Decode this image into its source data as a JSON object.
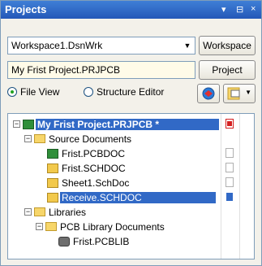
{
  "panel": {
    "title": "Projects",
    "title_buttons": [
      "▾",
      "⊟",
      "×"
    ]
  },
  "workspace": {
    "value": "Workspace1.DsnWrk",
    "button_label": "Workspace"
  },
  "project": {
    "value": "My Frist Project.PRJPCB",
    "button_label": "Project"
  },
  "view": {
    "options": [
      "File View",
      "Structure Editor"
    ],
    "selected": "File View"
  },
  "tree": {
    "project": "My Frist Project.PRJPCB *",
    "source_documents": "Source Documents",
    "docs": [
      "Frist.PCBDOC",
      "Frist.SCHDOC",
      "Sheet1.SchDoc",
      "Receive.SCHDOC"
    ],
    "libraries": "Libraries",
    "pcb_library_documents": "PCB Library Documents",
    "lib_file": "Frist.PCBLIB"
  },
  "colors": {
    "title_bg": "#2f6bcb",
    "selection": "#3169c6",
    "status_red": "#d42020"
  }
}
